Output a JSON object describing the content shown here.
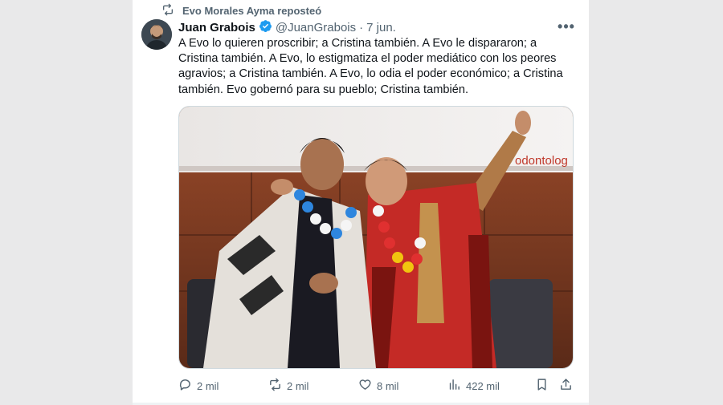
{
  "repost": {
    "icon": "repost-icon",
    "text": "Evo Morales Ayma reposteó"
  },
  "author": {
    "name": "Juan Grabois",
    "handle": "@JuanGrabois",
    "separator": "·",
    "date": "7 jun.",
    "verified_icon": "verified-badge-icon",
    "verified_color": "#1d9bf0"
  },
  "tweet": {
    "text": "A Evo lo quieren proscribir; a Cristina también. A Evo le dispararon; a Cristina también. A Evo, lo estigmatiza el poder mediático con los peores agravios; a Cristina también. A Evo, lo odia el poder económico; a Cristina también. Evo gobernó para su pueblo; Cristina también."
  },
  "media": {
    "banner_text": "odontolog",
    "description_icon": "photo"
  },
  "actions": {
    "replies": "2 mil",
    "reposts": "2 mil",
    "likes": "8 mil",
    "views": "422 mil"
  },
  "colors": {
    "text": "#0f1419",
    "muted": "#536471",
    "accent": "#1d9bf0"
  }
}
